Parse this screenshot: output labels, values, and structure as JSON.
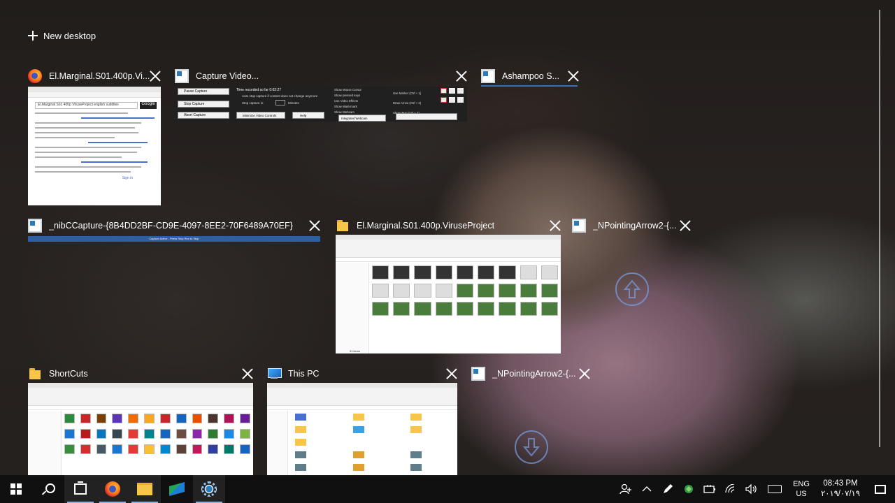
{
  "new_desktop": {
    "label": "New desktop"
  },
  "windows": [
    {
      "title": "El.Marginal.S01.400p.Vi...",
      "app": "firefox",
      "thumb_caption": "El.Marginal S01 400p ViruseProject english subtitles",
      "thumb_brand": "Google",
      "thumb_link": "Sign in"
    },
    {
      "title": "Capture Video...",
      "app": "window",
      "buttons": [
        "Pause Capture",
        "Stop Capture",
        "Abort Capture",
        "Minimize Video Controls",
        "Help"
      ],
      "status": "Time recorded so far 0:02:27",
      "options": [
        "Auto stop capture if content does not change anymore",
        "Stop capture in:",
        "Minutes"
      ],
      "checks": [
        "Show Mouse Cursor",
        "Show pressed keys",
        "Use Video Effects",
        "Show Watermark",
        "Show Webcam"
      ],
      "webcam": "Integrated Webcam",
      "markers": [
        "Use Marker (Ctrl + 1)",
        "Draw Arrow (Ctrl + 2)",
        "Show Text (Ctrl + 3)"
      ]
    },
    {
      "title": "Ashampoo S...",
      "app": "window"
    },
    {
      "title": "_nibCCapture-{8B4DD2BF-CD9E-4097-8EE2-70F6489A70EF}",
      "app": "window",
      "strip": "Capture Active - Press  Stop Rec to Stop"
    },
    {
      "title": "El.Marginal.S01.400p.ViruseProject",
      "app": "folder",
      "status_bar": "53 items"
    },
    {
      "title": "_NPointingArrow2-{...",
      "app": "window"
    },
    {
      "title": "ShortCuts",
      "app": "folder"
    },
    {
      "title": "This PC",
      "app": "pc"
    },
    {
      "title": "_NPointingArrow2-{...",
      "app": "window"
    }
  ],
  "taskbar": {
    "language": {
      "lang": "ENG",
      "region": "US"
    },
    "clock": {
      "time": "08:43 PM",
      "date": "۲۰۱۹/۰۷/۱۹"
    }
  },
  "colors": {
    "taskbar": "#101010",
    "accent": "#8ab4e8",
    "active_underline": "#3a6fb5"
  }
}
